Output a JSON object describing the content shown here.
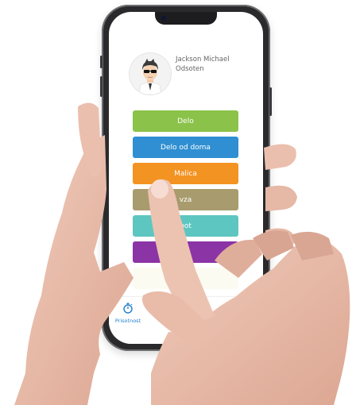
{
  "user": {
    "name": "Jackson Michael Odsoten"
  },
  "menu": {
    "items": [
      {
        "label": "Delo",
        "color": "#8bc24a"
      },
      {
        "label": "Delo od doma",
        "color": "#2f8fd2"
      },
      {
        "label": "Malica",
        "color": "#f39322"
      },
      {
        "label": "vza",
        "color": "#a89b6d"
      },
      {
        "label": "pot",
        "color": "#5ec6c0"
      },
      {
        "label": "",
        "color": "#8b34a6"
      }
    ]
  },
  "nav": {
    "active_label": "Prisotnost",
    "accent": "#1f7fcf"
  },
  "colors": {
    "skin": "#e9bfae",
    "skin_shadow": "#d3a08e",
    "frame": "#2a2a2c"
  }
}
